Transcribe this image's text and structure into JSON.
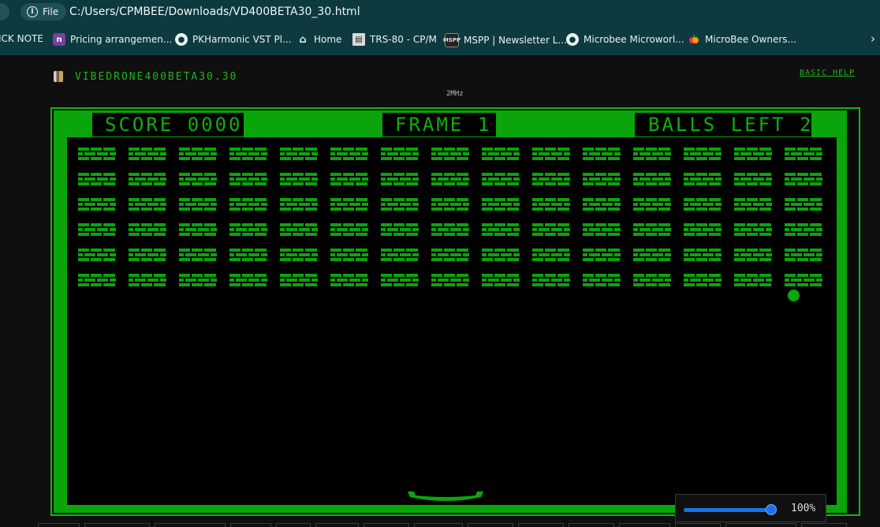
{
  "browser": {
    "file_label": "File",
    "url": "C:/Users/CPMBEE/Downloads/VD400BETA30_30.html"
  },
  "bookmarks": [
    {
      "label": "ICK NOTE",
      "icon": "none"
    },
    {
      "label": "Pricing arrangemen...",
      "icon": "n-icon",
      "glyph": "n"
    },
    {
      "label": "PKHarmonic VST Pl...",
      "icon": "globe-icon",
      "glyph": "●"
    },
    {
      "label": "Home",
      "icon": "home-icon",
      "glyph": "⌂"
    },
    {
      "label": "TRS-80 - CP/M",
      "icon": "trs80-icon",
      "glyph": "▤"
    },
    {
      "label": "MSPP | Newsletter L...",
      "icon": "mspp-icon",
      "glyph": "MSPP"
    },
    {
      "label": "Microbee Microworl...",
      "icon": "globe-icon",
      "glyph": "●"
    },
    {
      "label": "MicroBee Owners...",
      "icon": "apple-icon",
      "glyph": ""
    }
  ],
  "app": {
    "title": "VIBEDRONE400BETA30.30",
    "help_link": "BASIC HELP",
    "clock": "2MHz"
  },
  "game": {
    "score_text": "SCORE 0000",
    "frame_text": "FRAME 1",
    "balls_text": "BALLS LEFT 2",
    "bricks": {
      "rows": 6,
      "columns": 15
    },
    "colors": {
      "phosphor": "#0fae0f",
      "brick": "#0aa50a",
      "background": "#000000"
    }
  },
  "zoom": {
    "value_text": "100%",
    "level": 1.0
  }
}
